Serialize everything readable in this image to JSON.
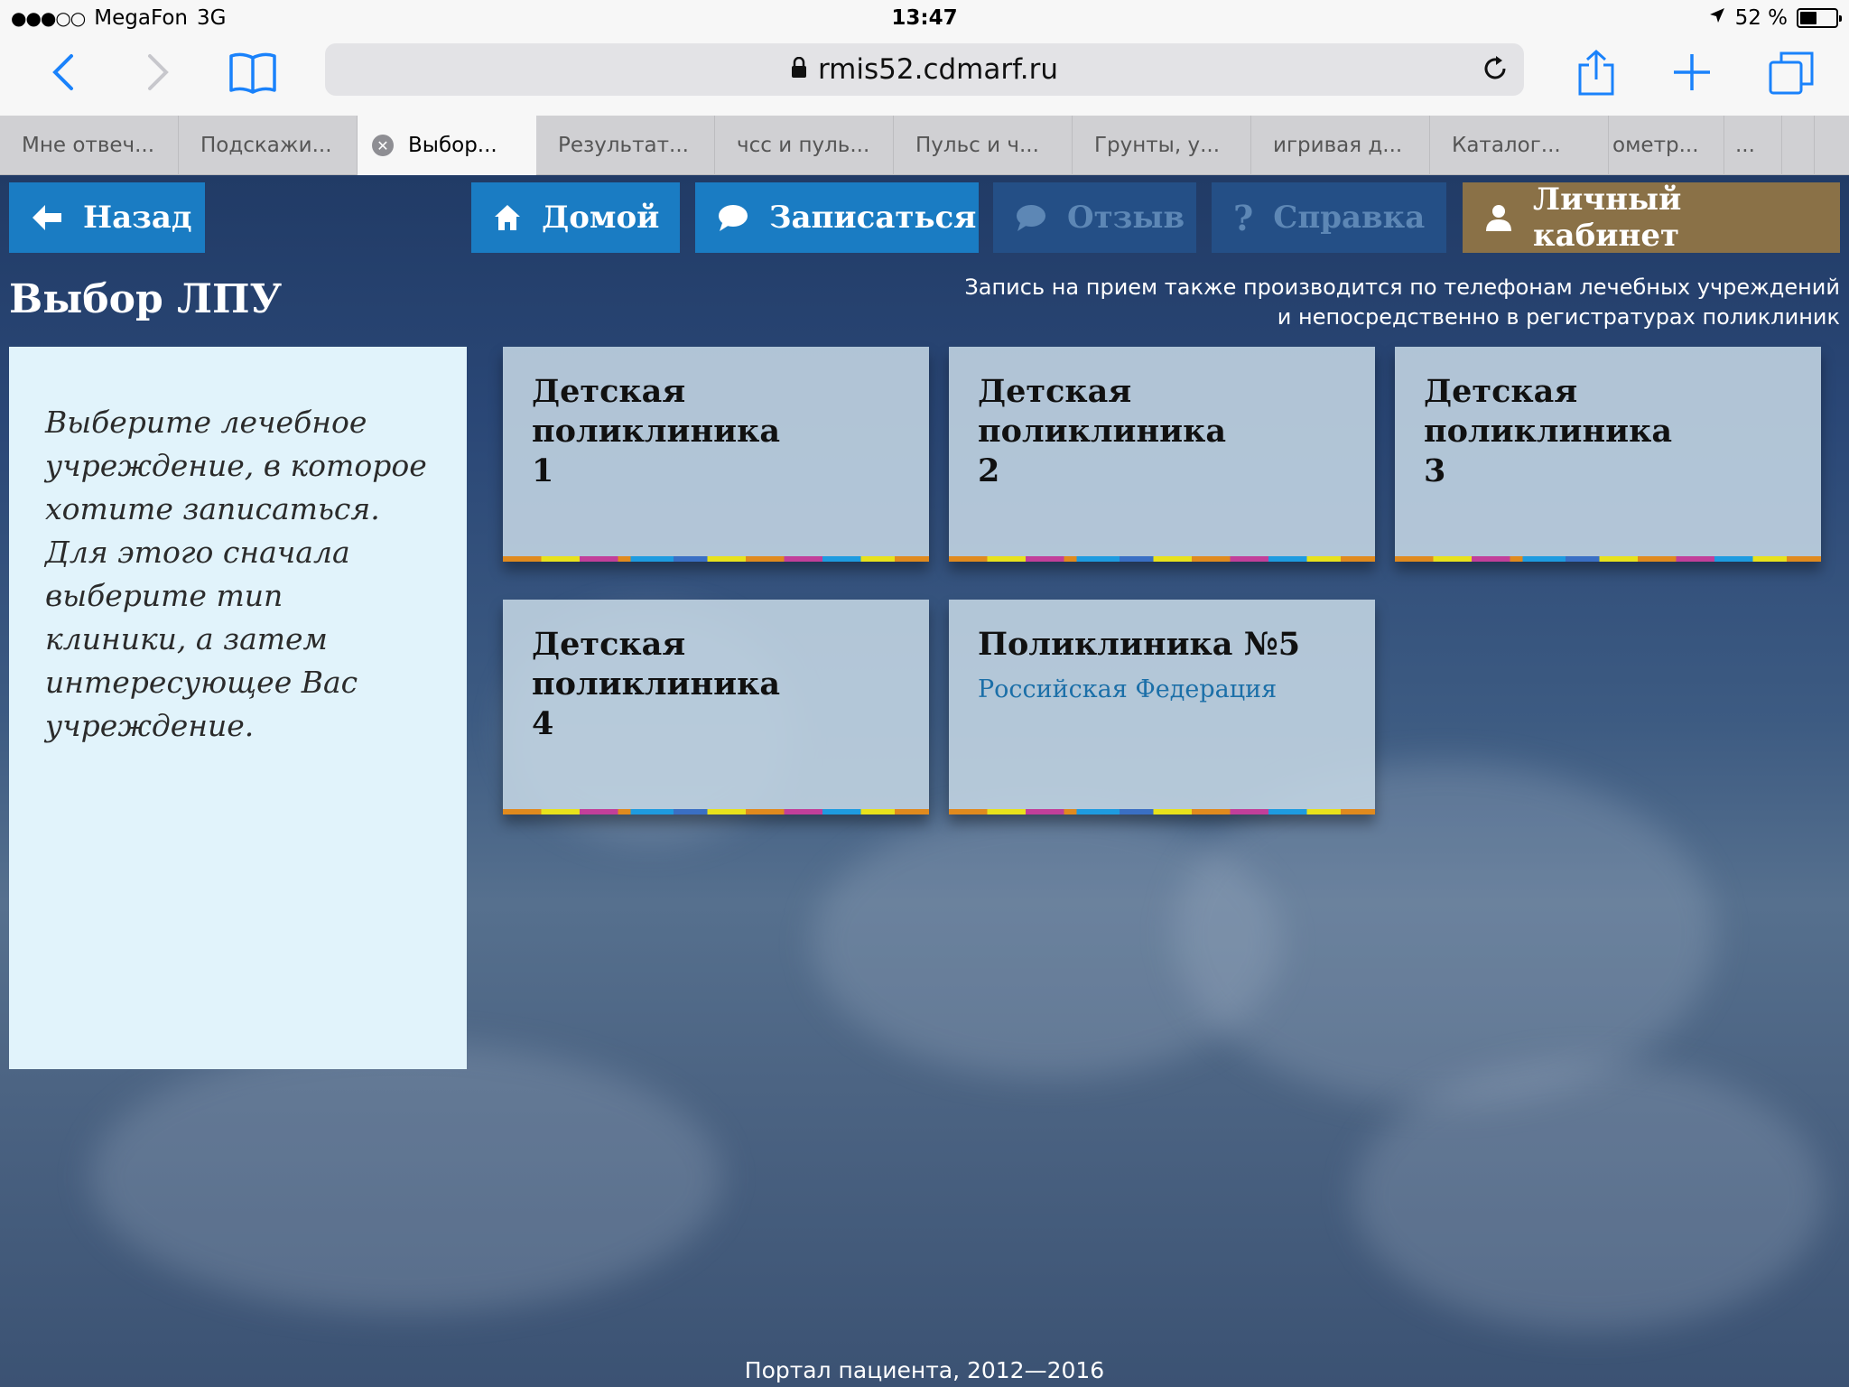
{
  "status_bar": {
    "signal_dots": "●●●○○",
    "carrier": "MegaFon",
    "network": "3G",
    "time": "13:47",
    "battery_text": "52 %",
    "battery_level": 0.52
  },
  "browser": {
    "url": "rmis52.cdmarf.ru",
    "icons": [
      "back-icon",
      "forward-icon",
      "bookmarks-icon",
      "lock-icon",
      "reload-icon",
      "share-icon",
      "new-tab-icon",
      "tabs-icon"
    ]
  },
  "tabs": [
    {
      "label": "Мне отвеч..."
    },
    {
      "label": "Подскажи..."
    },
    {
      "label": "Выбор...",
      "active": true
    },
    {
      "label": "Результат..."
    },
    {
      "label": "чсс и пуль..."
    },
    {
      "label": "Пульс и ч..."
    },
    {
      "label": "Грунты, у..."
    },
    {
      "label": "игривая д..."
    },
    {
      "label": "Каталог..."
    },
    {
      "label": "ометр..."
    },
    {
      "label": "..."
    }
  ],
  "nav": {
    "back": "Назад",
    "home": "Домой",
    "signup": "Записаться",
    "feedback": "Отзыв",
    "help": "Справка",
    "cabinet": "Личный кабинет"
  },
  "page": {
    "title": "Выбор ЛПУ",
    "notice_line1": "Запись на прием также производится по телефонам лечебных учреждений",
    "notice_line2": "и непосредственно в регистратурах поликлиник",
    "sidebar_text": "Выберите лечебное учреждение, в которое хотите записаться. Для этого сначала выберите тип клиники, а затем интересующее Вас учреждение."
  },
  "clinics": [
    {
      "line1": "Детская поликлиника",
      "line2": "1",
      "subtitle": ""
    },
    {
      "line1": "Детская поликлиника",
      "line2": "2",
      "subtitle": ""
    },
    {
      "line1": "Детская поликлиника",
      "line2": "3",
      "subtitle": ""
    },
    {
      "line1": "Детская поликлиника",
      "line2": "4",
      "subtitle": ""
    },
    {
      "line1": "Поликлиника №5",
      "line2": "",
      "subtitle": "Российская Федерация"
    }
  ],
  "footer": "Портал пациента, 2012—2016",
  "colors": {
    "nav_blue": "#1a7cc3",
    "nav_disabled": "#244f86",
    "nav_cabinet": "#8a7147",
    "sidebar_bg": "#e1f3fb",
    "card_bg": "#c4d6e4",
    "link_blue": "#1b6fa8",
    "ios_blue": "#1a82fb"
  }
}
